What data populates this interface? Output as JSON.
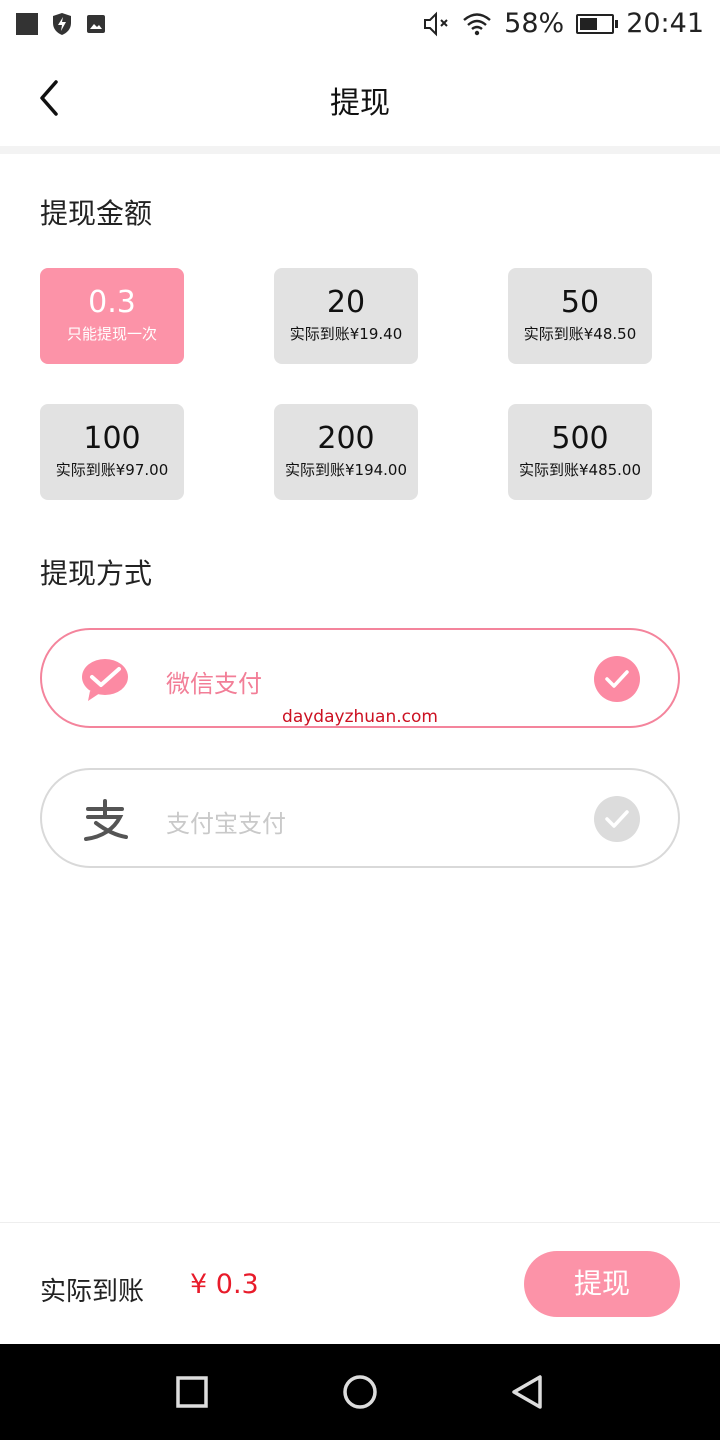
{
  "status_bar": {
    "battery": "58%",
    "time": "20:41",
    "battery_level": 0.58
  },
  "header": {
    "title": "提现"
  },
  "amount_section": {
    "title": "提现金额",
    "options": [
      {
        "value": "0.3",
        "note": "只能提现一次",
        "selected": true
      },
      {
        "value": "20",
        "note": "实际到账¥19.40",
        "selected": false
      },
      {
        "value": "50",
        "note": "实际到账¥48.50",
        "selected": false
      },
      {
        "value": "100",
        "note": "实际到账¥97.00",
        "selected": false
      },
      {
        "value": "200",
        "note": "实际到账¥194.00",
        "selected": false
      },
      {
        "value": "500",
        "note": "实际到账¥485.00",
        "selected": false
      }
    ]
  },
  "method_section": {
    "title": "提现方式",
    "options": [
      {
        "label": "微信支付",
        "icon": "wechat-pay-icon",
        "selected": true
      },
      {
        "label": "支付宝支付",
        "icon": "alipay-icon",
        "selected": false
      }
    ]
  },
  "watermark": "daydayzhuan.com",
  "footer": {
    "total_label": "实际到账",
    "total_value": "¥ 0.3",
    "submit_label": "提现"
  },
  "colors": {
    "accent": "#fc93a8",
    "accent_border": "#f4849c",
    "price": "#e81b2a",
    "card_bg": "#e2e2e2"
  }
}
